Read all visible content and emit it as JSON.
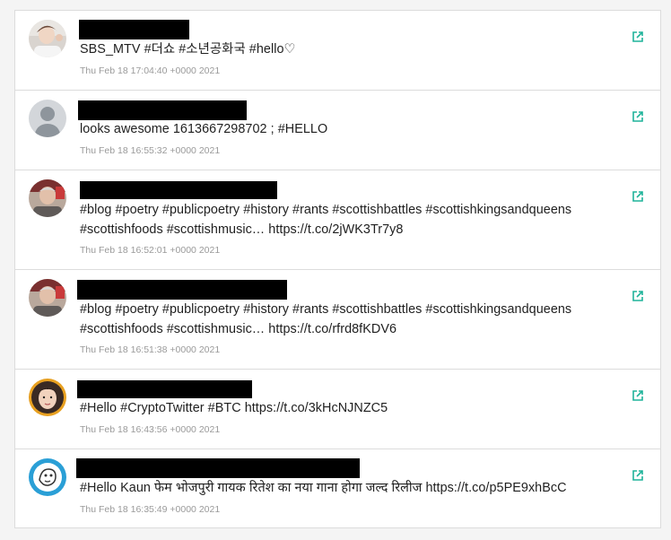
{
  "accent_color": "#1fb39a",
  "tweets": [
    {
      "text": "SBS_MTV #더쇼 #소년공화국 #hello♡",
      "timestamp": "Thu Feb 18 17:04:40 +0000 2021",
      "avatar": "person-photo-avatar",
      "link_icon": "external-link-icon"
    },
    {
      "text": "looks awesome 1613667298702 ; #HELLO",
      "timestamp": "Thu Feb 18 16:55:32 +0000 2021",
      "avatar": "default-user-avatar",
      "link_icon": "external-link-icon"
    },
    {
      "text": "#blog #poetry #publicpoetry #history #rants #scottishbattles #scottishkingsandqueens #scottishfoods #scottishmusic… https://t.co/2jWK3Tr7y8",
      "timestamp": "Thu Feb 18 16:52:01 +0000 2021",
      "avatar": "person-photo-avatar",
      "link_icon": "external-link-icon"
    },
    {
      "text": "#blog #poetry #publicpoetry #history #rants #scottishbattles #scottishkingsandqueens #scottishfoods #scottishmusic… https://t.co/rfrd8fKDV6",
      "timestamp": "Thu Feb 18 16:51:38 +0000 2021",
      "avatar": "person-photo-avatar",
      "link_icon": "external-link-icon"
    },
    {
      "text": "#Hello #CryptoTwitter #BTC https://t.co/3kHcNJNZC5",
      "timestamp": "Thu Feb 18 16:43:56 +0000 2021",
      "avatar": "person-photo-avatar",
      "link_icon": "external-link-icon"
    },
    {
      "text": "#Hello Kaun फेम भोजपुरी गायक रितेश का नया गाना होगा जल्द रिलीज https://t.co/p5PE9xhBcC",
      "timestamp": "Thu Feb 18 16:35:49 +0000 2021",
      "avatar": "cartoon-logo-avatar",
      "link_icon": "external-link-icon"
    }
  ]
}
